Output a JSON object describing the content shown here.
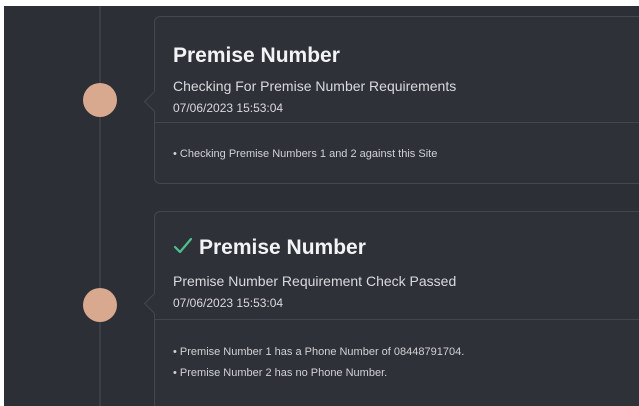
{
  "timeline": {
    "events": [
      {
        "title": "Premise Number",
        "subtitle": "Checking For Premise Number Requirements",
        "timestamp": "07/06/2023 15:53:04",
        "details": [
          "• Checking Premise Numbers 1 and 2 against this Site"
        ],
        "status_icon": ""
      },
      {
        "title": "Premise Number",
        "subtitle": "Premise Number Requirement Check Passed",
        "timestamp": "07/06/2023 15:53:04",
        "details": [
          "• Premise Number 1 has a Phone Number of 08448791704.",
          "• Premise Number 2 has no Phone Number."
        ],
        "status_icon": "check-icon"
      }
    ]
  },
  "colors": {
    "background": "#2d2f36",
    "card_border": "#45474f",
    "node": "#d9a98f",
    "check": "#4fc08d"
  }
}
